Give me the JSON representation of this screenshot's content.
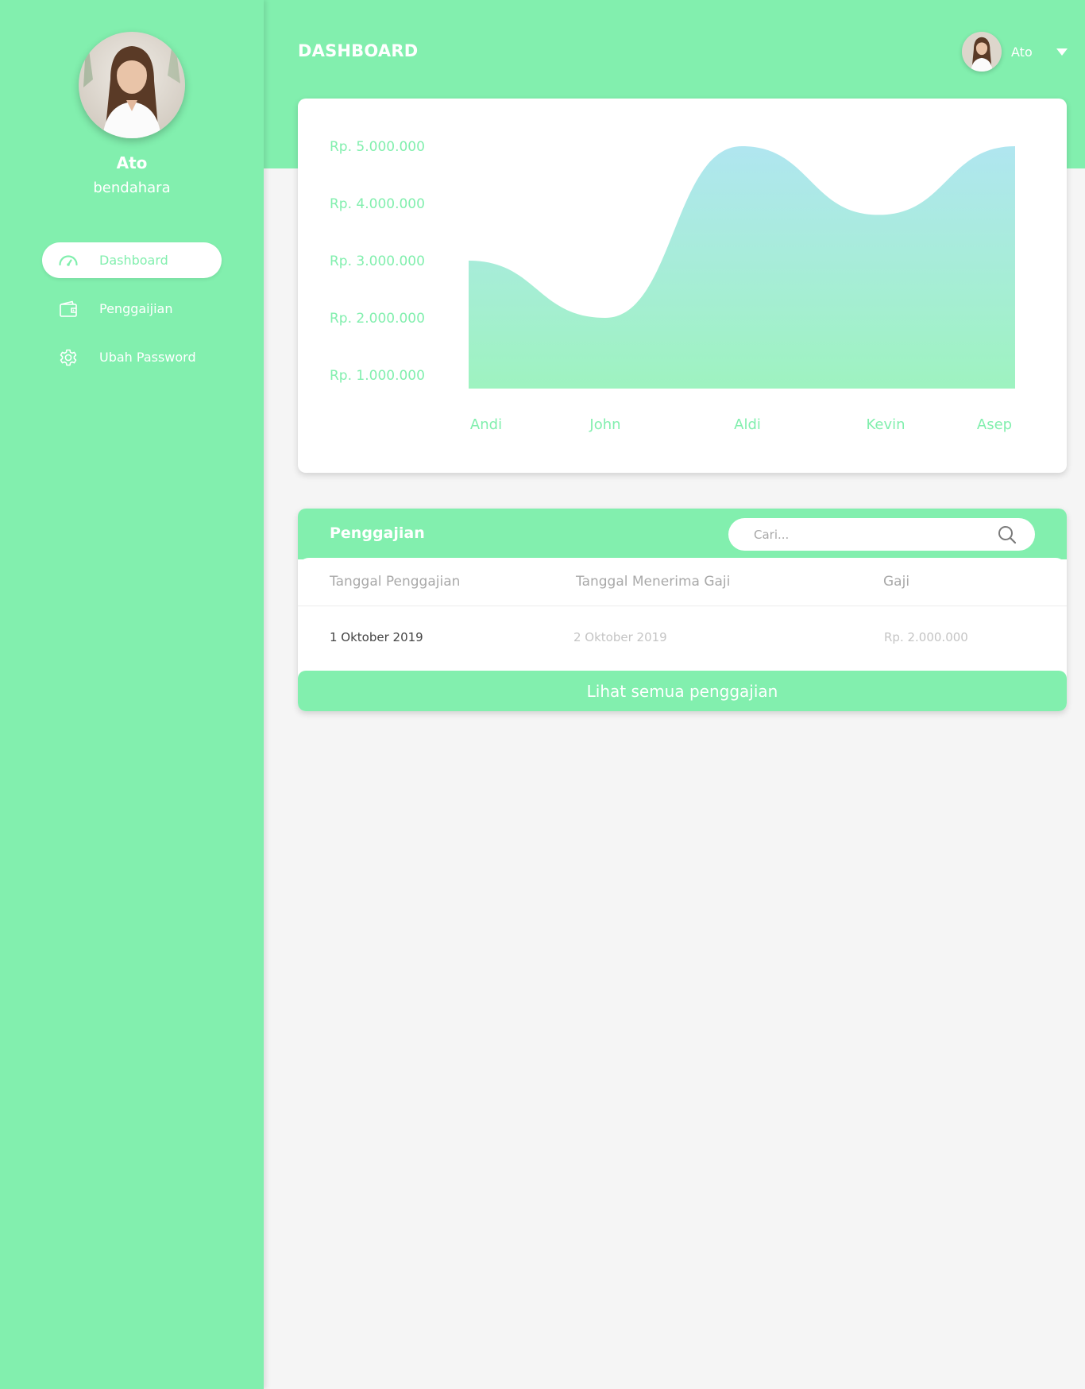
{
  "colors": {
    "accent": "#82efae",
    "chart_top": "#b0e6f0",
    "chart_bottom": "#9ef3c0",
    "background": "#f5f5f5"
  },
  "sidebar": {
    "profile": {
      "name": "Ato",
      "role": "bendahara"
    },
    "items": [
      {
        "label": "Dashboard",
        "icon": "speedometer-icon",
        "active": true
      },
      {
        "label": "Penggaijian",
        "icon": "wallet-icon",
        "active": false
      },
      {
        "label": "Ubah Password",
        "icon": "gear-icon",
        "active": false
      }
    ]
  },
  "header": {
    "title": "DASHBOARD",
    "user_name": "Ato"
  },
  "chart_data": {
    "type": "area",
    "categories": [
      "Andi",
      "John",
      "Aldi",
      "Kevin",
      "Asep"
    ],
    "values": [
      3000000,
      2000000,
      5000000,
      3800000,
      5000000
    ],
    "y_tick_labels": [
      "Rp. 5.000.000",
      "Rp. 4.000.000",
      "Rp. 3.000.000",
      "Rp. 2.000.000",
      "Rp. 1.000.000"
    ],
    "ylim": [
      800000,
      5000000
    ],
    "grid": false,
    "smooth": true
  },
  "payroll": {
    "title": "Penggajian",
    "search_placeholder": "Cari...",
    "columns": [
      "Tanggal Penggajian",
      "Tanggal Menerima Gaji",
      "Gaji"
    ],
    "rows": [
      [
        "1 Oktober 2019",
        "2 Oktober 2019",
        "Rp. 2.000.000"
      ]
    ],
    "view_all_label": "Lihat semua penggajian"
  }
}
